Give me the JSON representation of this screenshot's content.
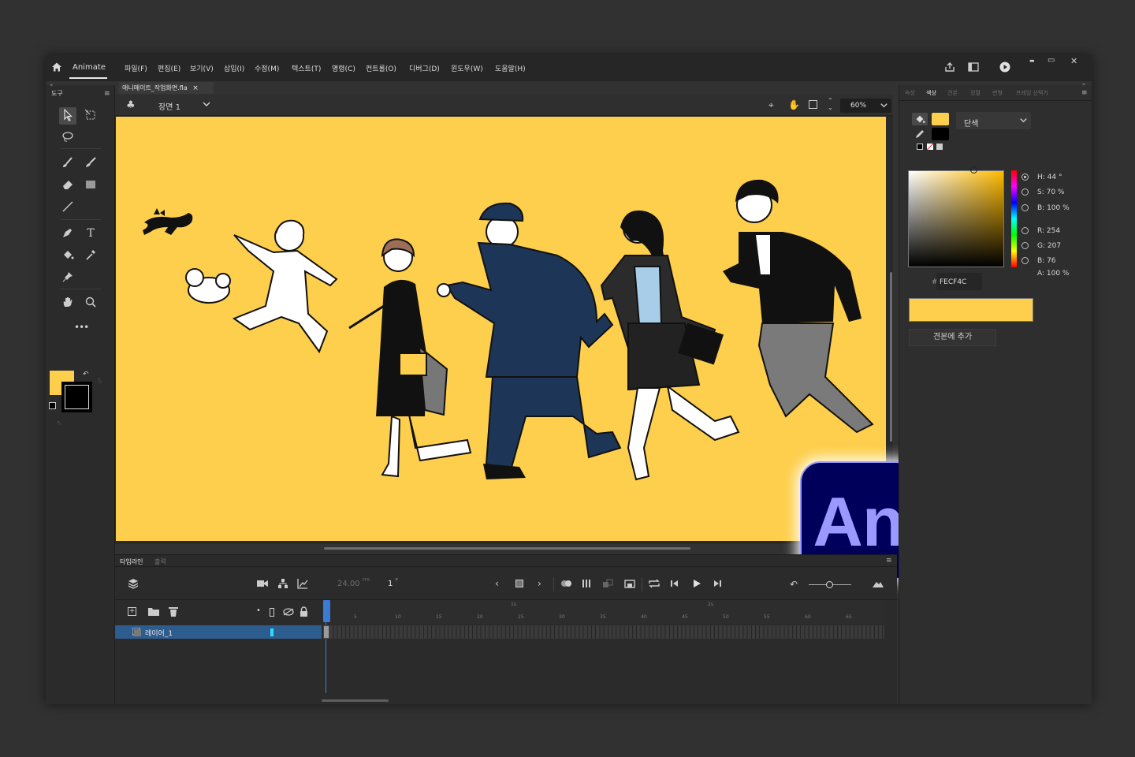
{
  "app": {
    "home_icon": "home-icon",
    "app_tab": "Animate"
  },
  "menu": [
    "파일(F)",
    "편집(E)",
    "보기(V)",
    "삽입(I)",
    "수정(M)",
    "텍스트(T)",
    "명령(C)",
    "컨트롤(O)",
    "디버그(D)",
    "윈도우(W)",
    "도움말(H)"
  ],
  "window_controls": {
    "minimize": "▬",
    "restore": "▭",
    "close": "✕"
  },
  "tools_panel": {
    "title": "도구"
  },
  "document": {
    "tab_title": "애니메이트_작업화면.fla",
    "tab_close": "×",
    "scene": "장면 1",
    "zoom": "60%"
  },
  "colors": {
    "fill": "#fecf4c",
    "stroke": "#000000",
    "stage": "#fecf4c",
    "logo_bg": "#00005b",
    "logo_fg": "#9999ff"
  },
  "right_panel": {
    "tabs": [
      "속성",
      "색상",
      "견본",
      "정렬",
      "변형",
      "프레임 선택기"
    ],
    "active_tab": "색상",
    "fill_type": "단색",
    "hsb": {
      "h": "H: 44 °",
      "s": "S: 70 %",
      "b": "B: 100 %"
    },
    "rgb": {
      "r": "R: 254",
      "g": "G: 207",
      "b": "B: 76"
    },
    "alpha": "A: 100 %",
    "hex_prefix": "#",
    "hex": "FECF4C",
    "add_swatch": "견본에 추가"
  },
  "timeline": {
    "tabs": [
      "타임라인",
      "출력"
    ],
    "fps": "24.00",
    "fps_unit": "FPS",
    "frame": "1",
    "frame_unit": "F",
    "layer_name": "레이어_1",
    "frame_numbers": [
      "5",
      "10",
      "15",
      "20",
      "25",
      "30",
      "35",
      "40",
      "45",
      "50",
      "55",
      "60",
      "65"
    ],
    "seconds": [
      "1s",
      "2s"
    ]
  },
  "logo": {
    "text": "An"
  }
}
